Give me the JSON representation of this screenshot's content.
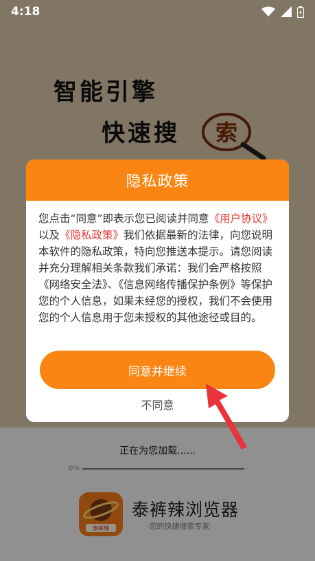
{
  "status_bar": {
    "time": "4:18"
  },
  "splash": {
    "slogan_line1": "智能引擎",
    "slogan_line2": "快速搜",
    "slogan_highlight": "索",
    "loading_text": "正在为您加载......",
    "progress_percent": "0%",
    "progress_value": 0,
    "app_logo_text": "泰裤辣",
    "app_name": "泰裤辣浏览器",
    "app_tagline": "·您的快捷搜索专家·"
  },
  "dialog": {
    "title": "隐私政策",
    "body_prefix": "您点击“同意”即表示您已阅读并同意",
    "link_user_agreement": "《用户协议》",
    "body_and": "以及",
    "link_privacy_policy": "《隐私政策》",
    "body_rest": "我们依据最新的法律，向您说明本软件的隐私政策，特向您推送本提示。请您阅读并充分理解相关条款我们承诺：我们会严格按照《网络安全法》、《信息网络传播保护条例》等保护您的个人信息，如果未经您的授权，我们不会使用您的个人信息用于您未授权的其他途径或目的。",
    "agree_label": "同意并继续",
    "disagree_label": "不同意"
  },
  "colors": {
    "accent": "#fb8512",
    "link": "#e53935",
    "annotation_arrow": "#e8323c"
  },
  "icons": [
    "wifi-icon",
    "signal-icon",
    "battery-icon",
    "magnifier-icon",
    "app-logo-icon",
    "pointer-arrow-icon"
  ]
}
